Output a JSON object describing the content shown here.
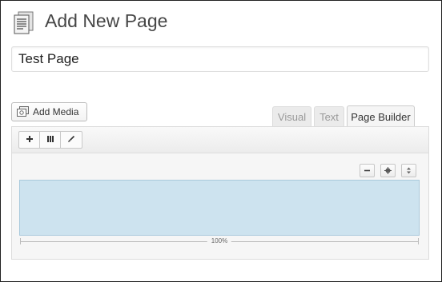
{
  "header": {
    "title": "Add New Page",
    "icon": "page-icon"
  },
  "title_field": {
    "value": "Test Page"
  },
  "media": {
    "add_media_label": "Add Media",
    "icon": "media-icon"
  },
  "editor_tabs": [
    {
      "label": "Visual",
      "active": false
    },
    {
      "label": "Text",
      "active": false
    },
    {
      "label": "Page Builder",
      "active": true
    }
  ],
  "builder_toolbar": {
    "buttons": [
      {
        "name": "add-widget",
        "icon": "plus-icon"
      },
      {
        "name": "add-row",
        "icon": "columns-icon"
      },
      {
        "name": "prebuilt-layout",
        "icon": "brush-icon"
      }
    ]
  },
  "row": {
    "controls": [
      "minus-icon",
      "settings-icon",
      "move-icon"
    ],
    "width_label": "100%"
  },
  "colors": {
    "row_fill": "#cde3ef",
    "row_border": "#a9c9dc",
    "frame_border": "#222222"
  }
}
